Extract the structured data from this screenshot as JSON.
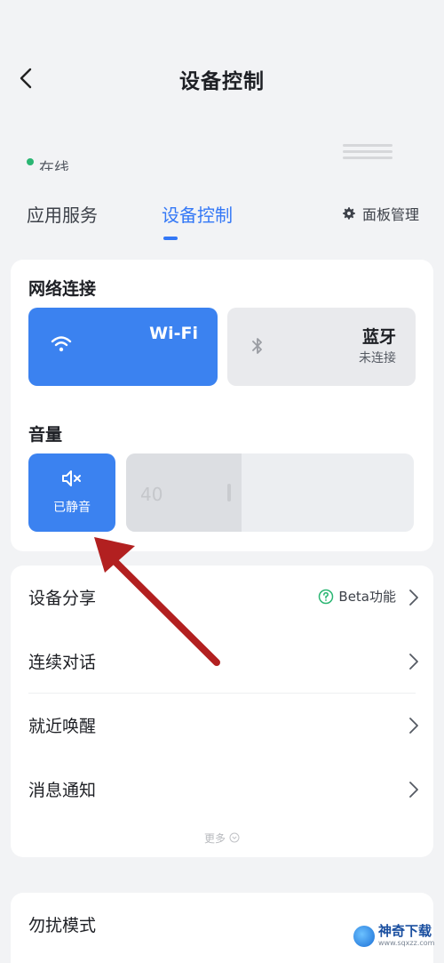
{
  "header": {
    "title": "设备控制",
    "status": "在线"
  },
  "tabs": {
    "items": [
      "应用服务",
      "设备控制"
    ],
    "active": 1,
    "panel_manage": "面板管理"
  },
  "network": {
    "title": "网络连接",
    "wifi_label": "Wi-Fi",
    "bluetooth_label": "蓝牙",
    "bluetooth_status": "未连接"
  },
  "volume": {
    "title": "音量",
    "mute_label": "已静音",
    "value": "40",
    "level": 0.4
  },
  "menu": {
    "items": [
      "设备分享",
      "连续对话",
      "就近唤醒",
      "消息通知"
    ],
    "beta_label": "Beta功能",
    "more_label": "更多"
  },
  "dnd": {
    "label": "勿扰模式"
  },
  "watermark": {
    "name": "神奇下载",
    "url": "www.sqxzz.com"
  },
  "colors": {
    "accent": "#3b82f0",
    "tab_active": "#3478f6",
    "status": "#2bb673",
    "annotation_arrow": "#b22020"
  }
}
